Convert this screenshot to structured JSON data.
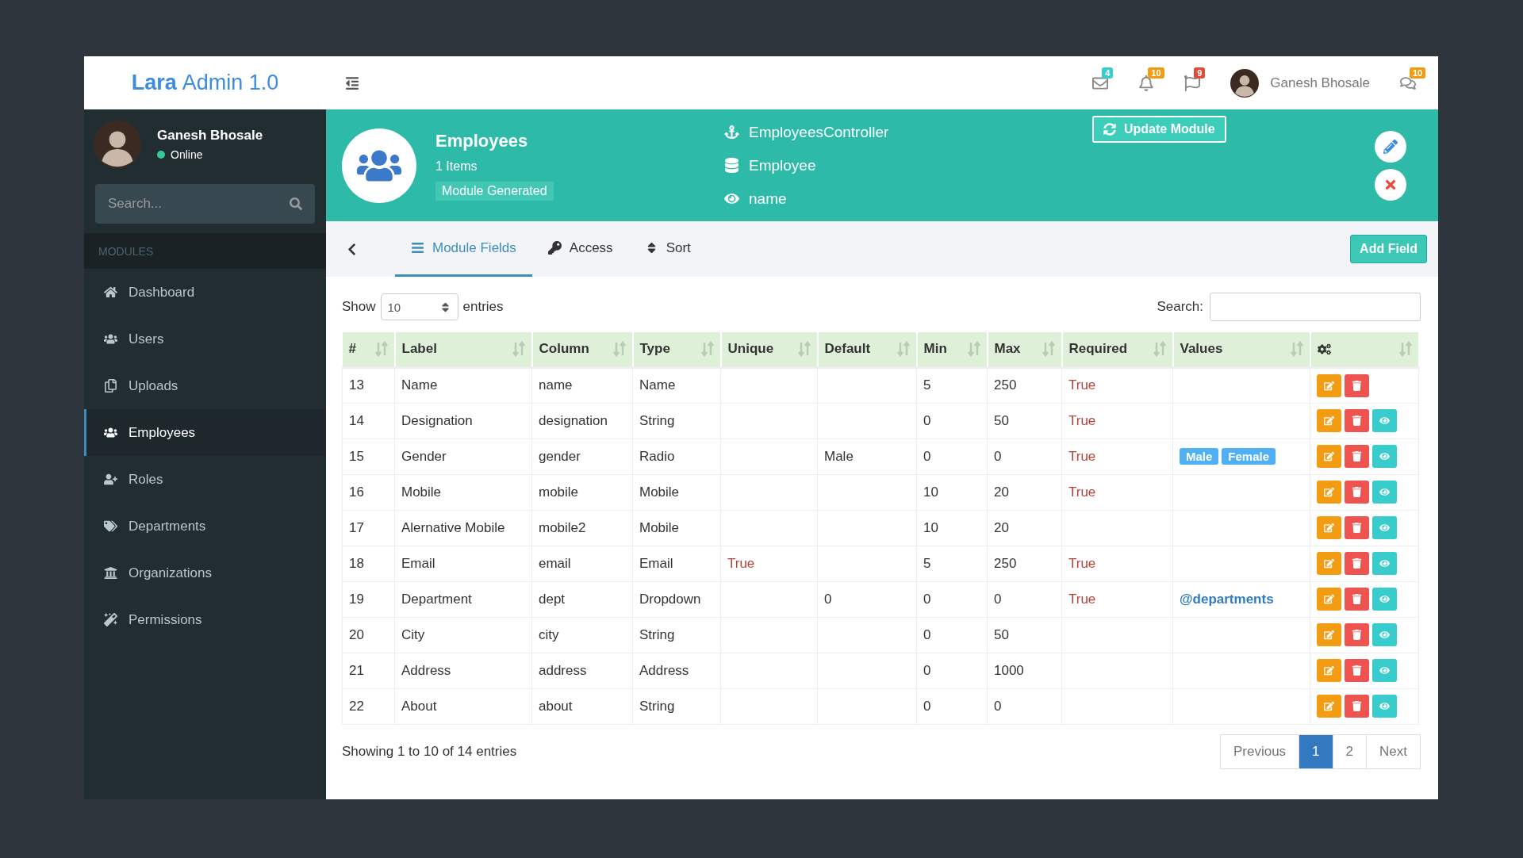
{
  "brand": {
    "bold": "Lara",
    "light": "Admin 1.0"
  },
  "header": {
    "notifications": [
      {
        "count": "4",
        "color": "#39cccc"
      },
      {
        "count": "10",
        "color": "#f39c12"
      },
      {
        "count": "9",
        "color": "#dd4b39"
      }
    ],
    "user_name": "Ganesh Bhosale",
    "chat_count": {
      "count": "10",
      "color": "#f39c12"
    }
  },
  "sidebar": {
    "user": {
      "name": "Ganesh Bhosale",
      "status": "Online"
    },
    "search": {
      "placeholder": "Search..."
    },
    "section": "MODULES",
    "items": [
      {
        "label": "Dashboard",
        "selected": false
      },
      {
        "label": "Users",
        "selected": false
      },
      {
        "label": "Uploads",
        "selected": false
      },
      {
        "label": "Employees",
        "selected": true
      },
      {
        "label": "Roles",
        "selected": false
      },
      {
        "label": "Departments",
        "selected": false
      },
      {
        "label": "Organizations",
        "selected": false
      },
      {
        "label": "Permissions",
        "selected": false
      }
    ]
  },
  "module": {
    "title": "Employees",
    "count": "1 Items",
    "status": "Module Generated",
    "controller": "EmployeesController",
    "model": "Employee",
    "view_column": "name",
    "update_button": "Update Module"
  },
  "tabs": [
    {
      "label": "Module Fields",
      "selected": true
    },
    {
      "label": "Access",
      "selected": false
    },
    {
      "label": "Sort",
      "selected": false
    }
  ],
  "add_button": "Add Field",
  "table": {
    "show_label": "Show",
    "entries_value": "10",
    "entries_label": "entries",
    "search_label": "Search:",
    "columns": [
      "#",
      "Label",
      "Column",
      "Type",
      "Unique",
      "Default",
      "Min",
      "Max",
      "Required",
      "Values"
    ],
    "rows": [
      {
        "cells": [
          "13",
          "Name",
          "name",
          "Name",
          "",
          "",
          "5",
          "250",
          "True"
        ],
        "viewable": false
      },
      {
        "cells": [
          "14",
          "Designation",
          "designation",
          "String",
          "",
          "",
          "0",
          "50",
          "True"
        ],
        "viewable": true
      },
      {
        "cells": [
          "15",
          "Gender",
          "gender",
          "Radio",
          "",
          "Male",
          "0",
          "0",
          "True"
        ],
        "values": {
          "kind": "tags",
          "items": [
            "Male",
            "Female"
          ]
        },
        "viewable": true
      },
      {
        "cells": [
          "16",
          "Mobile",
          "mobile",
          "Mobile",
          "",
          "",
          "10",
          "20",
          "True"
        ],
        "viewable": true
      },
      {
        "cells": [
          "17",
          "Alernative Mobile",
          "mobile2",
          "Mobile",
          "",
          "",
          "10",
          "20",
          ""
        ],
        "viewable": true
      },
      {
        "cells": [
          "18",
          "Email",
          "email",
          "Email",
          "True",
          "",
          "5",
          "250",
          "True"
        ],
        "viewable": true
      },
      {
        "cells": [
          "19",
          "Department",
          "dept",
          "Dropdown",
          "",
          "0",
          "0",
          "0",
          "True"
        ],
        "values": {
          "kind": "link",
          "text": "@departments"
        },
        "viewable": true
      },
      {
        "cells": [
          "20",
          "City",
          "city",
          "String",
          "",
          "",
          "0",
          "50",
          ""
        ],
        "viewable": true
      },
      {
        "cells": [
          "21",
          "Address",
          "address",
          "Address",
          "",
          "",
          "0",
          "1000",
          ""
        ],
        "viewable": true
      },
      {
        "cells": [
          "22",
          "About",
          "about",
          "String",
          "",
          "",
          "0",
          "0",
          ""
        ],
        "viewable": true
      }
    ],
    "info": "Showing 1 to 10 of 14 entries",
    "pagination": [
      {
        "label": "Previous",
        "selected": false
      },
      {
        "label": "1",
        "selected": true
      },
      {
        "label": "2",
        "selected": false
      },
      {
        "label": "Next",
        "selected": false
      }
    ]
  }
}
